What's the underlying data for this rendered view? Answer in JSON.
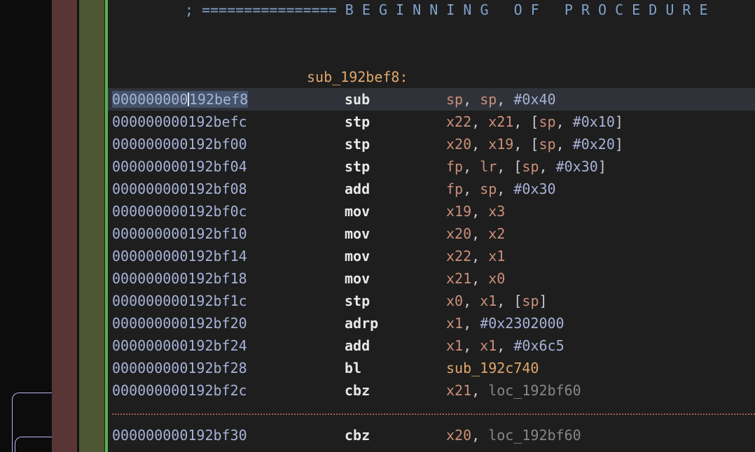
{
  "header_comment": {
    "prefix": "; ================",
    "title": " B E G I N N I N G   O F   P R O C E D U R E"
  },
  "procedure_label": "sub_192bef8:",
  "selected_address": {
    "highlighted": "000000000",
    "rest": "192bef8"
  },
  "instructions": [
    {
      "address": "000000000192bef8",
      "mnemonic": "sub",
      "operands": [
        [
          "reg",
          "sp"
        ],
        [
          "p",
          ", "
        ],
        [
          "reg",
          "sp"
        ],
        [
          "p",
          ", "
        ],
        [
          "imm",
          "#0x40"
        ]
      ]
    },
    {
      "address": "000000000192befc",
      "mnemonic": "stp",
      "operands": [
        [
          "reg",
          "x22"
        ],
        [
          "p",
          ", "
        ],
        [
          "reg",
          "x21"
        ],
        [
          "p",
          ", ["
        ],
        [
          "reg",
          "sp"
        ],
        [
          "p",
          ", "
        ],
        [
          "imm",
          "#0x10"
        ],
        [
          "p",
          "]"
        ]
      ]
    },
    {
      "address": "000000000192bf00",
      "mnemonic": "stp",
      "operands": [
        [
          "reg",
          "x20"
        ],
        [
          "p",
          ", "
        ],
        [
          "reg",
          "x19"
        ],
        [
          "p",
          ", ["
        ],
        [
          "reg",
          "sp"
        ],
        [
          "p",
          ", "
        ],
        [
          "imm",
          "#0x20"
        ],
        [
          "p",
          "]"
        ]
      ]
    },
    {
      "address": "000000000192bf04",
      "mnemonic": "stp",
      "operands": [
        [
          "reg",
          "fp"
        ],
        [
          "p",
          ", "
        ],
        [
          "reg",
          "lr"
        ],
        [
          "p",
          ", ["
        ],
        [
          "reg",
          "sp"
        ],
        [
          "p",
          ", "
        ],
        [
          "imm",
          "#0x30"
        ],
        [
          "p",
          "]"
        ]
      ]
    },
    {
      "address": "000000000192bf08",
      "mnemonic": "add",
      "operands": [
        [
          "reg",
          "fp"
        ],
        [
          "p",
          ", "
        ],
        [
          "reg",
          "sp"
        ],
        [
          "p",
          ", "
        ],
        [
          "imm",
          "#0x30"
        ]
      ]
    },
    {
      "address": "000000000192bf0c",
      "mnemonic": "mov",
      "operands": [
        [
          "reg",
          "x19"
        ],
        [
          "p",
          ", "
        ],
        [
          "reg",
          "x3"
        ]
      ]
    },
    {
      "address": "000000000192bf10",
      "mnemonic": "mov",
      "operands": [
        [
          "reg",
          "x20"
        ],
        [
          "p",
          ", "
        ],
        [
          "reg",
          "x2"
        ]
      ]
    },
    {
      "address": "000000000192bf14",
      "mnemonic": "mov",
      "operands": [
        [
          "reg",
          "x22"
        ],
        [
          "p",
          ", "
        ],
        [
          "reg",
          "x1"
        ]
      ]
    },
    {
      "address": "000000000192bf18",
      "mnemonic": "mov",
      "operands": [
        [
          "reg",
          "x21"
        ],
        [
          "p",
          ", "
        ],
        [
          "reg",
          "x0"
        ]
      ]
    },
    {
      "address": "000000000192bf1c",
      "mnemonic": "stp",
      "operands": [
        [
          "reg",
          "x0"
        ],
        [
          "p",
          ", "
        ],
        [
          "reg",
          "x1"
        ],
        [
          "p",
          ", ["
        ],
        [
          "reg",
          "sp"
        ],
        [
          "p",
          "]"
        ]
      ]
    },
    {
      "address": "000000000192bf20",
      "mnemonic": "adrp",
      "operands": [
        [
          "reg",
          "x1"
        ],
        [
          "p",
          ", "
        ],
        [
          "imm",
          "#0x2302000"
        ]
      ]
    },
    {
      "address": "000000000192bf24",
      "mnemonic": "add",
      "operands": [
        [
          "reg",
          "x1"
        ],
        [
          "p",
          ", "
        ],
        [
          "reg",
          "x1"
        ],
        [
          "p",
          ", "
        ],
        [
          "imm",
          "#0x6c5"
        ]
      ]
    },
    {
      "address": "000000000192bf28",
      "mnemonic": "bl",
      "operands": [
        [
          "sym",
          "sub_192c740"
        ]
      ]
    },
    {
      "address": "000000000192bf2c",
      "mnemonic": "cbz",
      "operands": [
        [
          "reg",
          "x21"
        ],
        [
          "p",
          ", "
        ],
        [
          "loc",
          "loc_192bf60"
        ]
      ]
    },
    {
      "address": "000000000192bf30",
      "mnemonic": "cbz",
      "operands": [
        [
          "reg",
          "x20"
        ],
        [
          "p",
          ", "
        ],
        [
          "loc",
          "loc_192bf60"
        ]
      ]
    }
  ],
  "colors": {
    "background": "#1e1e1e",
    "address": "#a8b2d8",
    "register": "#cc8f7a",
    "immediate": "#a8b2d8",
    "symbol": "#e0a66a",
    "location": "#878787",
    "comment": "#7fa2cc",
    "gutter_red": "#5a3535",
    "gutter_olive": "#4e5633",
    "gutter_green": "#56b24c",
    "separator": "#b0595b"
  }
}
